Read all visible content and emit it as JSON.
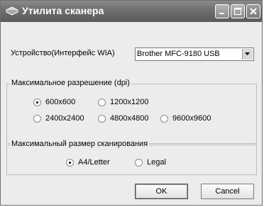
{
  "window": {
    "title": "Утилита сканера",
    "icon": "scanner-icon"
  },
  "device": {
    "label": "Устройство(Интерфейс WIA)",
    "selected": "Brother MFC-9180 USB"
  },
  "resolution": {
    "group_title": "Максимальное разрешение (dpi)",
    "options": [
      {
        "label": "600x600",
        "checked": true
      },
      {
        "label": "1200x1200",
        "checked": false
      },
      {
        "label": "2400x2400",
        "checked": false
      },
      {
        "label": "4800x4800",
        "checked": false
      },
      {
        "label": "9600x9600",
        "checked": false
      }
    ]
  },
  "scan_size": {
    "group_title": "Максимальный размер сканирования",
    "options": [
      {
        "label": "A4/Letter",
        "checked": true
      },
      {
        "label": "Legal",
        "checked": false
      }
    ]
  },
  "buttons": {
    "ok": "OK",
    "cancel": "Cancel"
  }
}
